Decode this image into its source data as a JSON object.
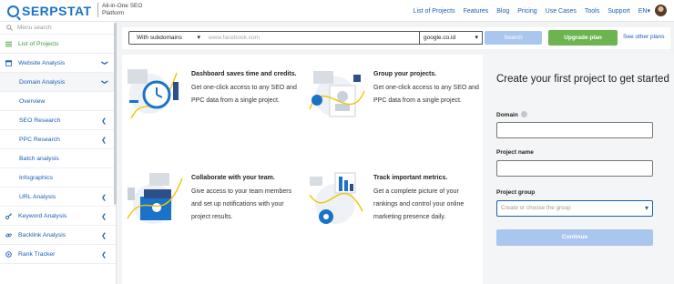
{
  "header": {
    "logo_text": "SERPSTAT",
    "tagline": "All-in-One SEO Platform",
    "nav": [
      "List of Projects",
      "Features",
      "Blog",
      "Pricing",
      "Use Cases",
      "Tools",
      "Support",
      "EN▾"
    ]
  },
  "sidebar": {
    "search_placeholder": "Menu search",
    "items": [
      {
        "label": "List of Projects"
      },
      {
        "label": "Website Analysis"
      },
      {
        "label": "Domain Analysis"
      },
      {
        "label": "Overview"
      },
      {
        "label": "SEO Research"
      },
      {
        "label": "PPC Research"
      },
      {
        "label": "Batch analysis"
      },
      {
        "label": "Infographics"
      },
      {
        "label": "URL Analysis"
      },
      {
        "label": "Keyword Analysis"
      },
      {
        "label": "Backlink Analysis"
      },
      {
        "label": "Rank Tracker"
      }
    ]
  },
  "searchbar": {
    "subdomains": "With subdomains",
    "domain_placeholder": "www.facebook.com",
    "database": "google.co.id",
    "search_label": "Search",
    "upgrade_label": "Upgrade plan",
    "other_plans": "See other plans"
  },
  "features": [
    {
      "title": "Dashboard saves time and credits.",
      "text": "Get one-click access to any SEO and PPC data from a single project."
    },
    {
      "title": "Group your projects.",
      "text": "Get one-click access to any SEO and PPC data from a single project."
    },
    {
      "title": "Collaborate with your team.",
      "text": "Give access to your team members and set up notifications with your project results."
    },
    {
      "title": "Track important metrics.",
      "text": "Get a complete picture of your rankings and control your online marketing presence daily."
    }
  ],
  "form": {
    "heading": "Create your first project to get started",
    "domain_label": "Domain",
    "project_name_label": "Project name",
    "project_group_label": "Project group",
    "project_group_placeholder": "Create or choose the group",
    "continue_label": "Continue"
  },
  "colors": {
    "brand": "#1a73c9",
    "link": "#1a5fb4",
    "upgrade": "#6cb450",
    "disabled_button": "#a9c6ee"
  }
}
